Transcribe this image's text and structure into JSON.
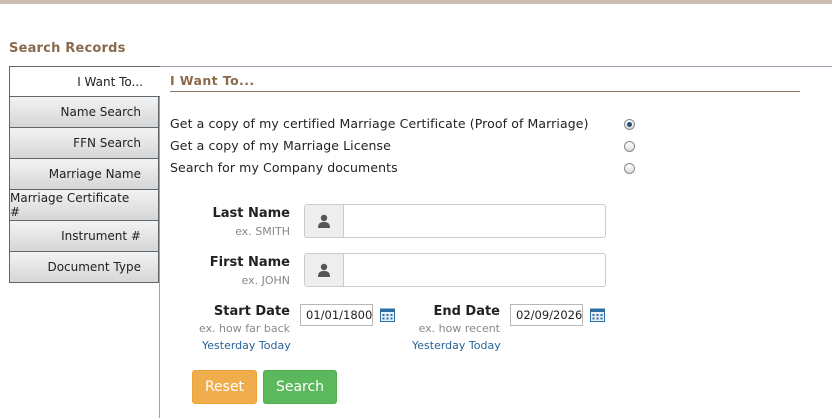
{
  "header": {
    "title": "Search Records"
  },
  "tabs": [
    {
      "label": "I Want To..."
    },
    {
      "label": "Name Search"
    },
    {
      "label": "FFN Search"
    },
    {
      "label": "Marriage Name"
    },
    {
      "label": "Marriage Certificate #"
    },
    {
      "label": "Instrument #"
    },
    {
      "label": "Document Type"
    }
  ],
  "panel": {
    "title": "I Want To...",
    "options": [
      {
        "label": "Get a copy of my certified Marriage Certificate (Proof of Marriage)",
        "selected": true
      },
      {
        "label": "Get a copy of my Marriage License",
        "selected": false
      },
      {
        "label": "Search for my Company documents",
        "selected": false
      }
    ]
  },
  "form": {
    "last_name": {
      "label": "Last Name",
      "hint": "ex. SMITH",
      "value": ""
    },
    "first_name": {
      "label": "First Name",
      "hint": "ex. JOHN",
      "value": ""
    },
    "start_date": {
      "label": "Start Date",
      "hint": "ex. how far back",
      "value": "01/01/1800",
      "link_yesterday": "Yesterday",
      "link_today": "Today"
    },
    "end_date": {
      "label": "End Date",
      "hint": "ex. how recent",
      "value": "02/09/2026",
      "link_yesterday": "Yesterday",
      "link_today": "Today"
    }
  },
  "buttons": {
    "reset": "Reset",
    "search": "Search"
  },
  "colors": {
    "reset": "#f0ad4e",
    "search": "#5cb85c",
    "heading": "#8a6a4c",
    "link": "#2a6496"
  },
  "icons": {
    "name_field": "user-icon",
    "date_field": "calendar-icon"
  }
}
